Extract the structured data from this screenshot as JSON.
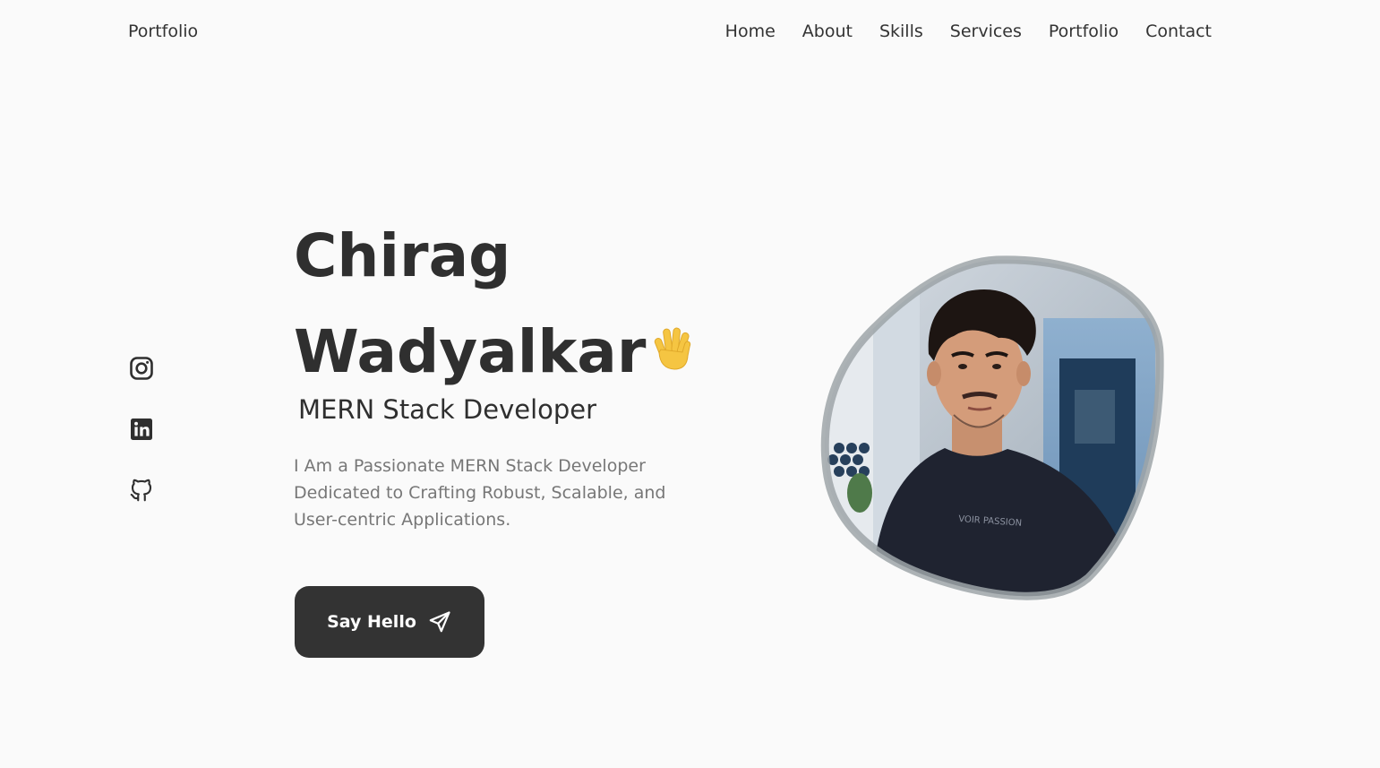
{
  "header": {
    "brand": "Portfolio",
    "nav": [
      "Home",
      "About",
      "Skills",
      "Services",
      "Portfolio",
      "Contact"
    ]
  },
  "social": {
    "icons": [
      "instagram-icon",
      "linkedin-icon",
      "github-icon"
    ]
  },
  "hero": {
    "name_first": "Chirag",
    "name_last": "Wadyalkar",
    "wave_emoji": "🖐",
    "role": "MERN Stack Developer",
    "description": "I Am a Passionate MERN Stack Developer Dedicated to Crafting Robust, Scalable, and User-centric Applications.",
    "cta_label": "Say Hello",
    "cta_icon": "send-icon"
  },
  "colors": {
    "background": "#fafafa",
    "text": "#2f2f2f",
    "muted": "#777777",
    "button": "#333333",
    "button_text": "#ffffff",
    "wave": "#f5c542"
  }
}
